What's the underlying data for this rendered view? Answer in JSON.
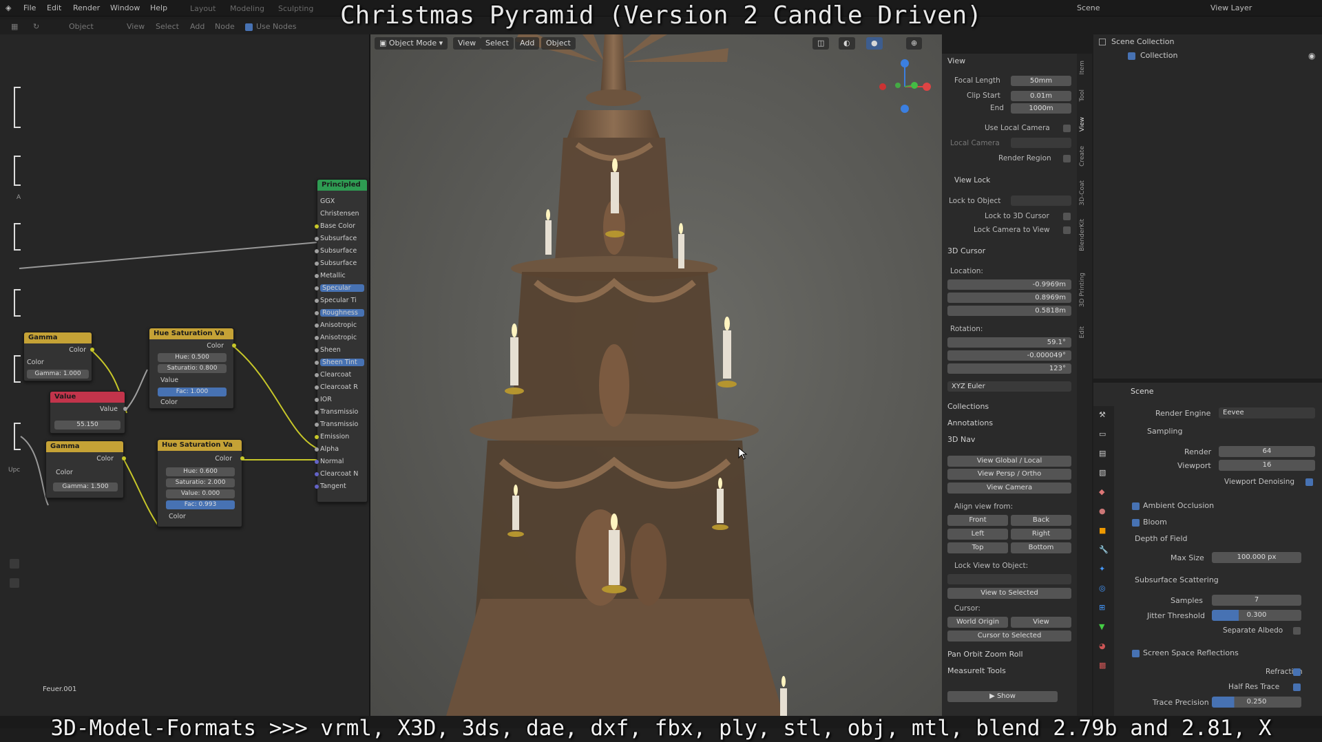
{
  "overlay": {
    "title": "Christmas Pyramid (Version 2 Candle Driven)",
    "caption": "3D-Model-Formats >>> vrml, X3D, 3ds, dae, dxf, fbx, ply, stl, obj, mtl, blend 2.79b and 2.81, X"
  },
  "topbar": {
    "menus": [
      "File",
      "Edit",
      "Render",
      "Window",
      "Help"
    ],
    "workspaces": [
      "Layout",
      "Modeling",
      "Sculpting"
    ],
    "scene": "Scene",
    "view_layer": "View Layer"
  },
  "node_editor": {
    "header": [
      "Object",
      "View",
      "Select",
      "Add",
      "Node",
      "Use Nodes"
    ],
    "footer_label": "Feuer.001",
    "left_labels": [
      "A",
      "Upc"
    ],
    "nodes": {
      "principled": {
        "title": "Principled",
        "sockets": [
          "GGX",
          "Christensen",
          "Base Color",
          "Subsurface",
          "Subsurface",
          "Subsurface",
          "Metallic",
          "Specular",
          "Specular Ti",
          "Roughness",
          "Anisotropic",
          "Anisotropic",
          "Sheen",
          "Sheen Tint",
          "Clearcoat",
          "Clearcoat R",
          "IOR",
          "Transmissio",
          "Transmissio",
          "Emission",
          "Alpha",
          "Normal",
          "Clearcoat N",
          "Tangent"
        ]
      },
      "gamma1": {
        "title": "Gamma",
        "out": "Color",
        "in": "Color",
        "param": "Gamma: 1.000"
      },
      "value": {
        "title": "Value",
        "out": "Value",
        "val": "55.150"
      },
      "gamma2": {
        "title": "Gamma",
        "out": "Color",
        "in": "Color",
        "param": "Gamma: 1.500"
      },
      "hue1": {
        "title": "Hue Saturation Va",
        "out": "Color",
        "hue": "Hue: 0.500",
        "sat": "Saturatio: 0.800",
        "value": "Value",
        "fac": "Fac: 1.000",
        "color": "Color"
      },
      "hue2": {
        "title": "Hue Saturation Va",
        "out": "Color",
        "hue": "Hue: 0.600",
        "sat": "Saturatio: 2.000",
        "value": "Value: 0.000",
        "fac": "Fac: 0.993",
        "color": "Color"
      }
    }
  },
  "viewport": {
    "mode": "Object Mode",
    "menus": [
      "View",
      "Select",
      "Add",
      "Object"
    ]
  },
  "npanel": {
    "view": {
      "title": "View",
      "focal_label": "Focal Length",
      "focal": "50mm",
      "clip_start_label": "Clip Start",
      "clip_start": "0.01m",
      "end_label": "End",
      "end": "1000m",
      "use_local_camera": "Use Local Camera",
      "local_camera": "Local Camera",
      "render_region": "Render Region",
      "view_lock": "View Lock",
      "lock_to_object": "Lock to Object",
      "lock_3d_cursor": "Lock to 3D Cursor",
      "lock_camera": "Lock Camera to View"
    },
    "cursor": {
      "title": "3D Cursor",
      "location": "Location:",
      "x": "-0.9969m",
      "y": "0.8969m",
      "z": "0.5818m",
      "rotation": "Rotation:",
      "rx": "59.1°",
      "ry": "-0.000049°",
      "rz": "123°",
      "euler": "XYZ Euler"
    },
    "collections": "Collections",
    "annotations": "Annotations",
    "nav": {
      "title": "3D Nav",
      "global_local": "View Global / Local",
      "persp_ortho": "View Persp / Ortho",
      "camera": "View Camera",
      "align": "Align view from:",
      "front": "Front",
      "back": "Back",
      "left": "Left",
      "right": "Right",
      "top": "Top",
      "bottom": "Bottom",
      "lock_view": "Lock View to Object:",
      "view_selected": "View to Selected",
      "cursor": "Cursor:",
      "world_origin": "World Origin",
      "view": "View",
      "cursor_selected": "Cursor to Selected"
    },
    "pan": "Pan Orbit Zoom Roll",
    "measureit": "MeasureIt Tools",
    "show": "Show",
    "tabs": [
      "Item",
      "Tool",
      "View",
      "Create",
      "3D-Coat",
      "BlenderKit",
      "3D Printing",
      "Edit"
    ]
  },
  "outliner": {
    "scene_collection": "Scene Collection",
    "collection": "Collection"
  },
  "properties": {
    "scene": "Scene",
    "render_engine_label": "Render Engine",
    "render_engine": "Eevee",
    "sampling": "Sampling",
    "render_label": "Render",
    "render": "64",
    "viewport_label": "Viewport",
    "viewport": "16",
    "denoising": "Viewport Denoising",
    "ao": "Ambient Occlusion",
    "bloom": "Bloom",
    "dof": "Depth of Field",
    "max_size_label": "Max Size",
    "max_size": "100.000 px",
    "sss": "Subsurface Scattering",
    "samples_label": "Samples",
    "samples": "7",
    "jitter_label": "Jitter Threshold",
    "jitter": "0.300",
    "separate_albedo": "Separate Albedo",
    "ssr": "Screen Space Reflections",
    "refraction": "Refraction",
    "half_res": "Half Res Trace",
    "trace_label": "Trace Precision",
    "trace": "0.250"
  }
}
